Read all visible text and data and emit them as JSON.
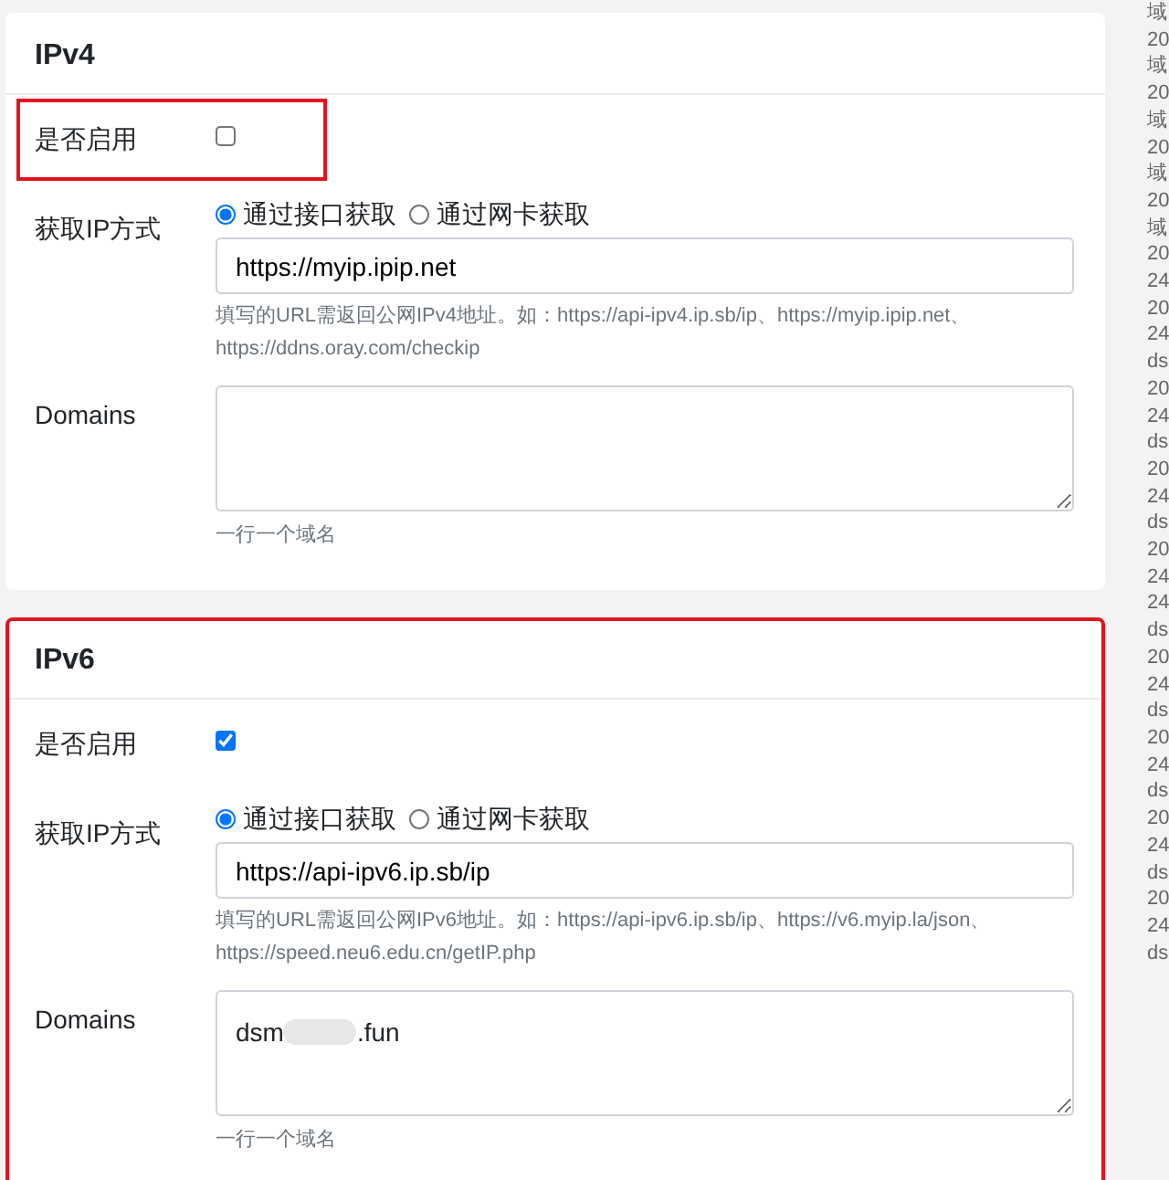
{
  "sections": [
    {
      "title": "IPv4",
      "highlighted": false,
      "enable": {
        "label": "是否启用",
        "checked": false,
        "highlighted": true
      },
      "method": {
        "label": "获取IP方式",
        "options": [
          {
            "label": "通过接口获取",
            "selected": true
          },
          {
            "label": "通过网卡获取",
            "selected": false
          }
        ]
      },
      "url": {
        "value": "https://myip.ipip.net"
      },
      "help": "填写的URL需返回公网IPv4地址。如：https://api-ipv4.ip.sb/ip、https://myip.ipip.net、https://ddns.oray.com/checkip",
      "domains": {
        "label": "Domains",
        "hint": "一行一个域名"
      }
    },
    {
      "title": "IPv6",
      "highlighted": true,
      "enable": {
        "label": "是否启用",
        "checked": true,
        "highlighted": false
      },
      "method": {
        "label": "获取IP方式",
        "options": [
          {
            "label": "通过接口获取",
            "selected": true
          },
          {
            "label": "通过网卡获取",
            "selected": false
          }
        ]
      },
      "url": {
        "value": "https://api-ipv6.ip.sb/ip"
      },
      "help": "填写的URL需返回公网IPv6地址。如：https://api-ipv6.ip.sb/ip、https://v6.myip.la/json、https://speed.neu6.edu.cn/getIP.php",
      "domains": {
        "label": "Domains",
        "value": "dsm",
        "value_suffix": ".fun",
        "hint": "一行一个域名"
      }
    }
  ],
  "log_lines": [
    "域",
    "20",
    "域",
    "20",
    "域",
    "20",
    "域",
    "20",
    "域",
    "20",
    "24",
    "20",
    "24",
    "ds",
    "20",
    "24",
    "ds",
    "20",
    "24",
    "ds",
    "20",
    "24",
    "24",
    "ds",
    "20",
    "24",
    "ds",
    "20",
    "24",
    "ds",
    "20",
    "24",
    "ds",
    "20",
    "24",
    "ds"
  ]
}
